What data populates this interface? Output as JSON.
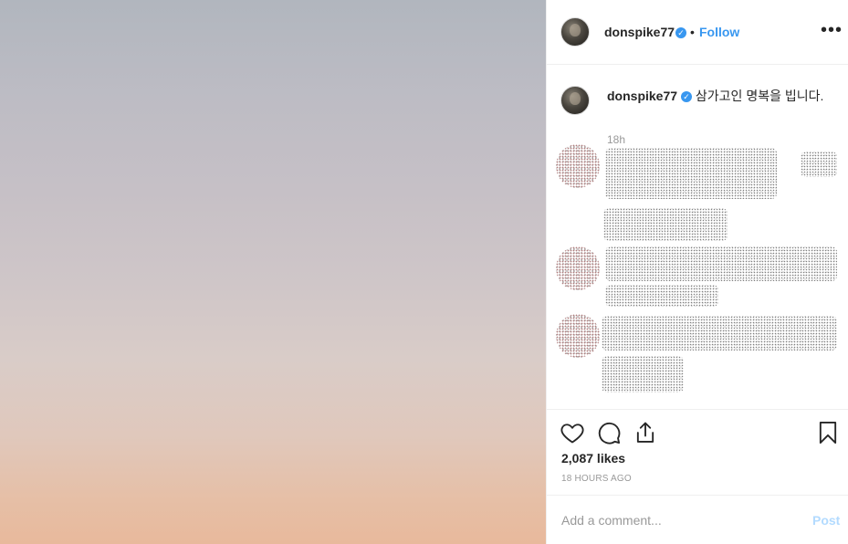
{
  "post": {
    "username": "donspike77",
    "follow_label": "Follow",
    "separator": "•",
    "more_icon": "more-horizontal-icon",
    "verified_icon": "verified-badge-icon"
  },
  "caption": {
    "username": "donspike77",
    "text": "삼가고인 명복을 빕니다.",
    "time": "18h"
  },
  "actions": {
    "icons": [
      "heart-icon",
      "comment-icon",
      "share-icon",
      "bookmark-icon"
    ],
    "likes": "2,087 likes",
    "timestamp": "18 HOURS AGO"
  },
  "comment": {
    "placeholder": "Add a comment...",
    "post_label": "Post"
  },
  "colors": {
    "accent": "#3897f0",
    "post_disabled": "#b3dbff",
    "muted": "#999999"
  }
}
